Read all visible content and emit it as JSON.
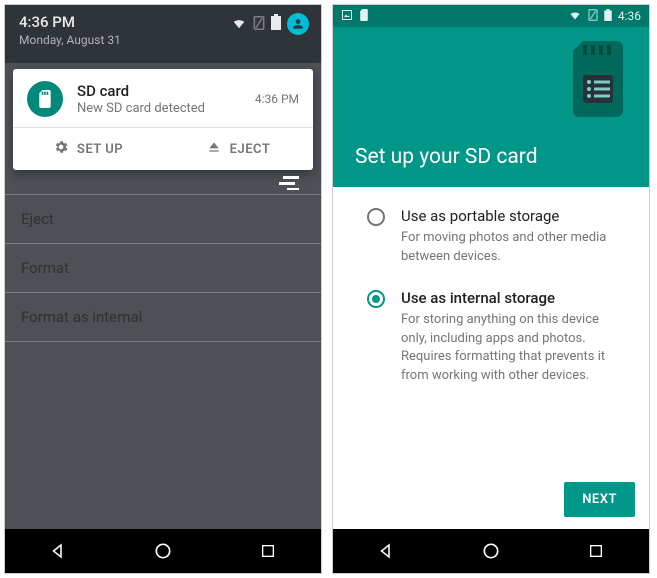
{
  "left": {
    "status": {
      "time": "4:36 PM",
      "date": "Monday, August 31"
    },
    "notification": {
      "title": "SD card",
      "subtitle": "New SD card detected",
      "time": "4:36 PM",
      "actions": {
        "setup": "SET UP",
        "eject": "EJECT"
      }
    },
    "menu": {
      "eject": "Eject",
      "format": "Format",
      "format_internal": "Format as internal"
    }
  },
  "right": {
    "status": {
      "time": "4:36"
    },
    "header": {
      "title": "Set up your SD card"
    },
    "options": {
      "portable": {
        "title": "Use as portable storage",
        "desc": "For moving photos and other media between devices.",
        "selected": false
      },
      "internal": {
        "title": "Use as internal storage",
        "desc": "For storing anything on this device only, including apps and photos. Requires formatting that prevents it from working with other devices.",
        "selected": true
      }
    },
    "next": "NEXT"
  },
  "colors": {
    "teal": "#009688",
    "teal_dark": "#00796b"
  }
}
